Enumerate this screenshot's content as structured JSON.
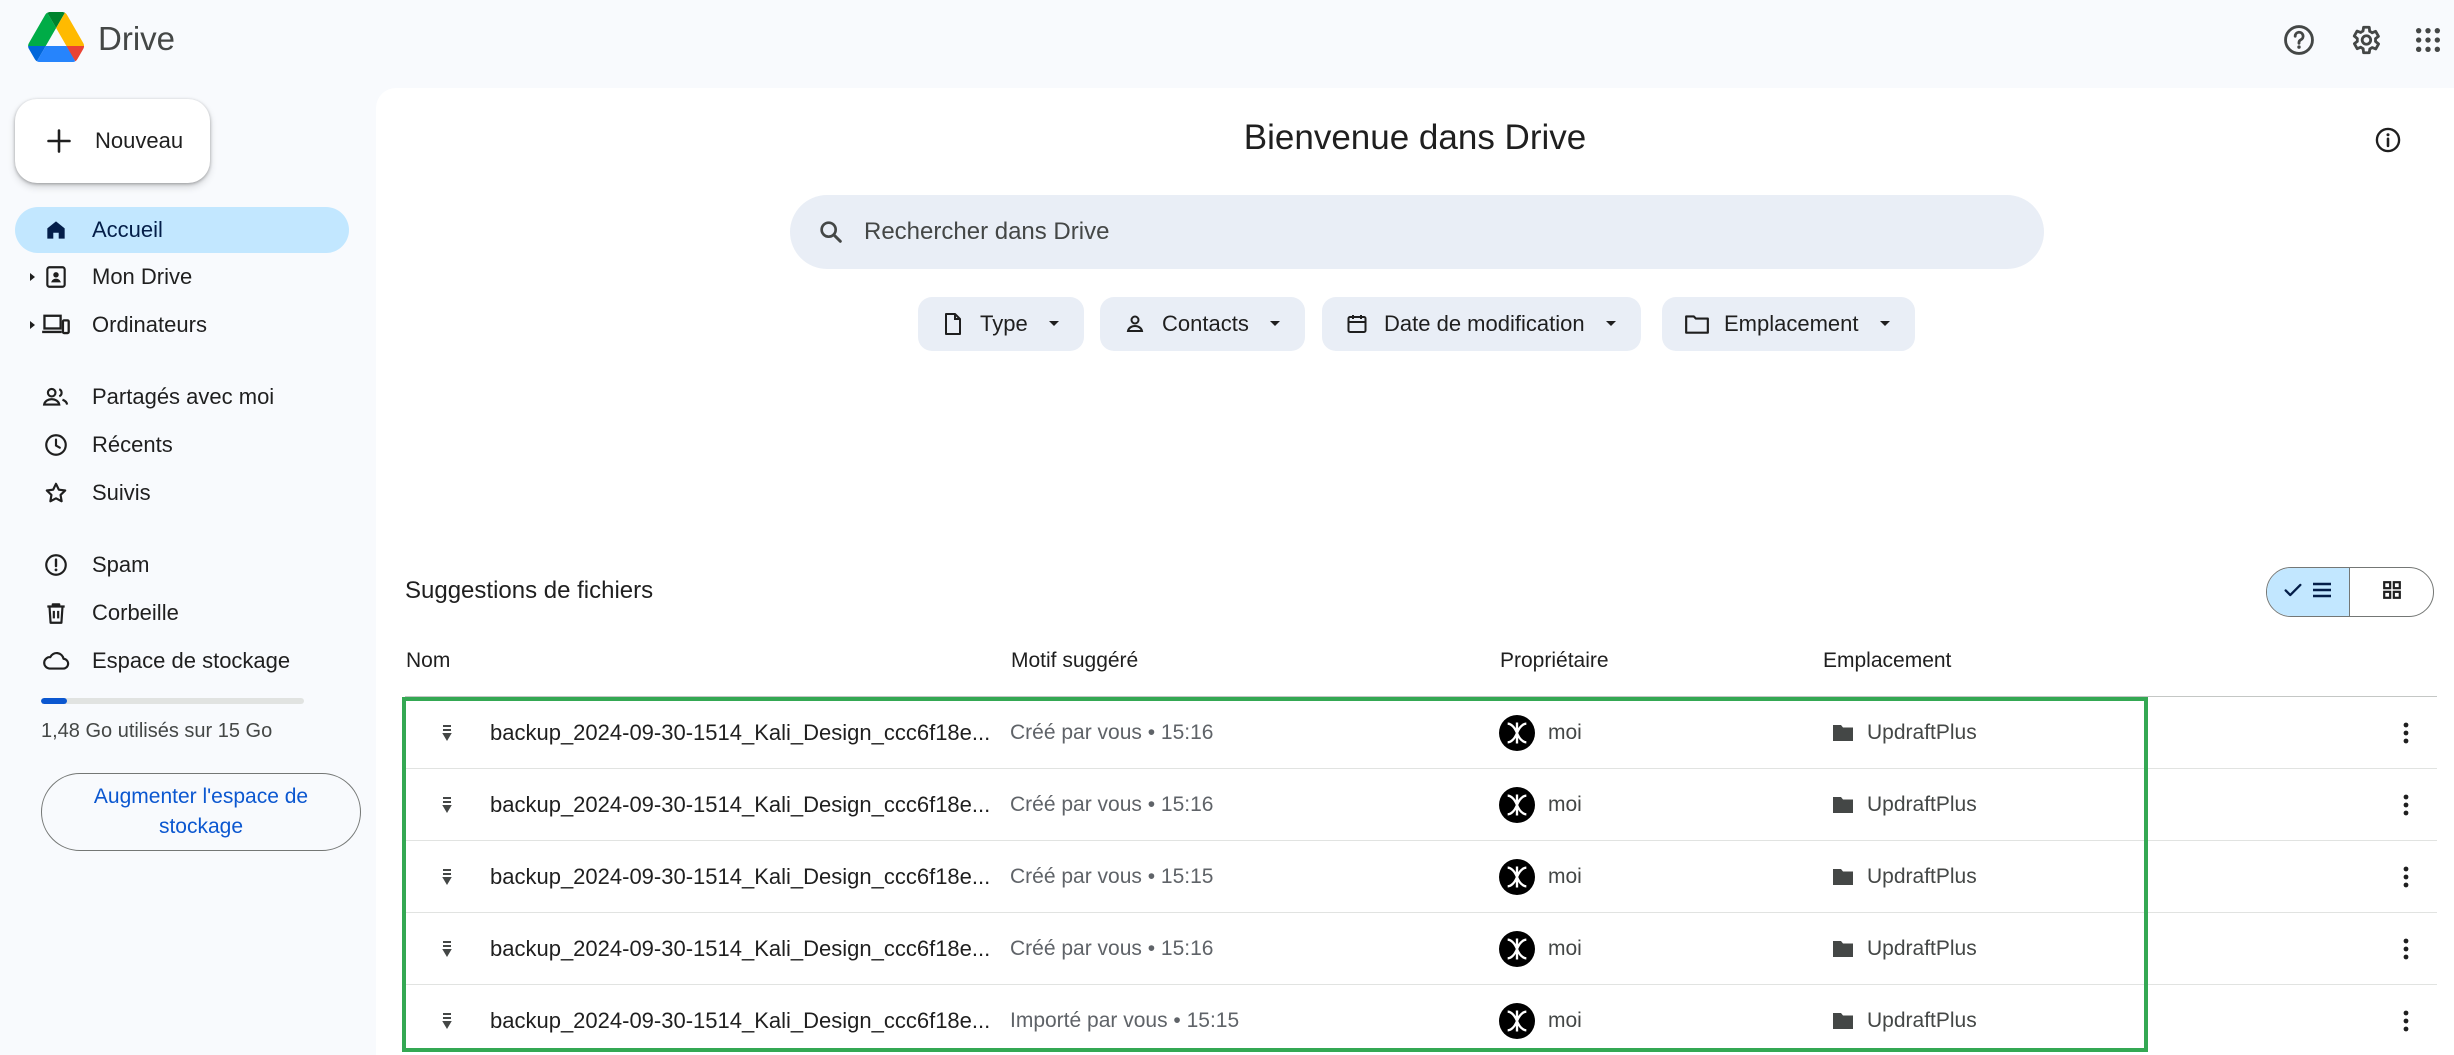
{
  "app": {
    "name": "Drive"
  },
  "header": {
    "icons": [
      "help-icon",
      "settings-icon",
      "apps-grid-icon"
    ]
  },
  "sidebar": {
    "new_label": "Nouveau",
    "items": [
      {
        "label": "Accueil",
        "icon": "home-icon",
        "active": true
      },
      {
        "label": "Mon Drive",
        "icon": "my-drive-icon",
        "expandable": true
      },
      {
        "label": "Ordinateurs",
        "icon": "computers-icon",
        "expandable": true
      },
      {
        "label": "Partagés avec moi",
        "icon": "shared-icon"
      },
      {
        "label": "Récents",
        "icon": "clock-icon"
      },
      {
        "label": "Suivis",
        "icon": "star-icon"
      },
      {
        "label": "Spam",
        "icon": "spam-icon"
      },
      {
        "label": "Corbeille",
        "icon": "trash-icon"
      },
      {
        "label": "Espace de stockage",
        "icon": "cloud-icon"
      }
    ],
    "storage": {
      "used_text": "1,48 Go utilisés sur 15 Go",
      "fraction": 0.099,
      "button_label": "Augmenter l'espace de stockage"
    }
  },
  "main": {
    "title": "Bienvenue dans Drive",
    "search": {
      "placeholder": "Rechercher dans Drive"
    },
    "filters": [
      {
        "label": "Type",
        "icon": "file-icon"
      },
      {
        "label": "Contacts",
        "icon": "person-icon"
      },
      {
        "label": "Date de modification",
        "icon": "calendar-icon"
      },
      {
        "label": "Emplacement",
        "icon": "folder-outline-icon"
      }
    ],
    "section_title": "Suggestions de fichiers",
    "columns": {
      "name": "Nom",
      "reason": "Motif suggéré",
      "owner": "Propriétaire",
      "location": "Emplacement"
    },
    "files": [
      {
        "name": "backup_2024-09-30-1514_Kali_Design_ccc6f18e...",
        "reason": "Créé par vous • 15:16",
        "owner": "moi",
        "location": "UpdraftPlus"
      },
      {
        "name": "backup_2024-09-30-1514_Kali_Design_ccc6f18e...",
        "reason": "Créé par vous • 15:16",
        "owner": "moi",
        "location": "UpdraftPlus"
      },
      {
        "name": "backup_2024-09-30-1514_Kali_Design_ccc6f18e...",
        "reason": "Créé par vous • 15:15",
        "owner": "moi",
        "location": "UpdraftPlus"
      },
      {
        "name": "backup_2024-09-30-1514_Kali_Design_ccc6f18e...",
        "reason": "Créé par vous • 15:16",
        "owner": "moi",
        "location": "UpdraftPlus"
      },
      {
        "name": "backup_2024-09-30-1514_Kali_Design_ccc6f18e...",
        "reason": "Importé par vous • 15:15",
        "owner": "moi",
        "location": "UpdraftPlus"
      }
    ]
  },
  "colors": {
    "accent": "#0b57d0",
    "active_nav": "#c2e7ff",
    "highlight": "#34a853"
  }
}
